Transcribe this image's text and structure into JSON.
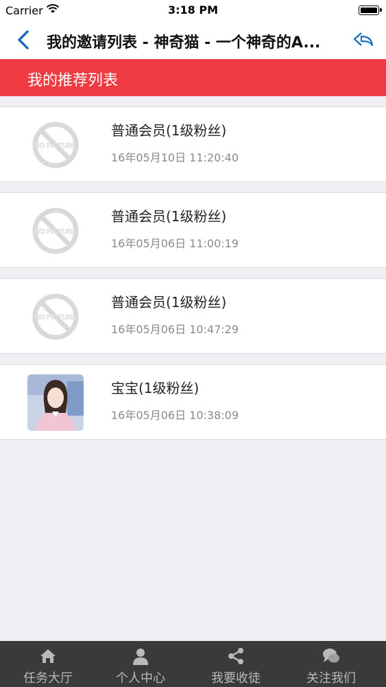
{
  "status_bar": {
    "carrier": "Carrier",
    "time": "3:18 PM"
  },
  "nav": {
    "title": "我的邀请列表 - 神奇猫 - 一个神奇的A...",
    "back_icon": "chevron-left-icon",
    "share_icon": "reply-icon"
  },
  "section": {
    "title": "我的推荐列表"
  },
  "members": [
    {
      "name": "普通会员(1级粉丝)",
      "date": "16年05月10日 11:20:40",
      "avatar": "no-picture"
    },
    {
      "name": "普通会员(1级粉丝)",
      "date": "16年05月06日 11:00:19",
      "avatar": "no-picture"
    },
    {
      "name": "普通会员(1级粉丝)",
      "date": "16年05月06日 10:47:29",
      "avatar": "no-picture"
    },
    {
      "name": "宝宝(1级粉丝)",
      "date": "16年05月06日 10:38:09",
      "avatar": "photo"
    }
  ],
  "no_picture_text": "NO PICTURE",
  "tabs": [
    {
      "label": "任务大厅",
      "icon": "home-icon"
    },
    {
      "label": "个人中心",
      "icon": "person-icon"
    },
    {
      "label": "我要收徒",
      "icon": "share-icon"
    },
    {
      "label": "关注我们",
      "icon": "chat-icon"
    }
  ],
  "colors": {
    "accent": "#ef3a41",
    "nav_tint": "#1a6ec1",
    "tab_bar": "#3a3a3a"
  }
}
